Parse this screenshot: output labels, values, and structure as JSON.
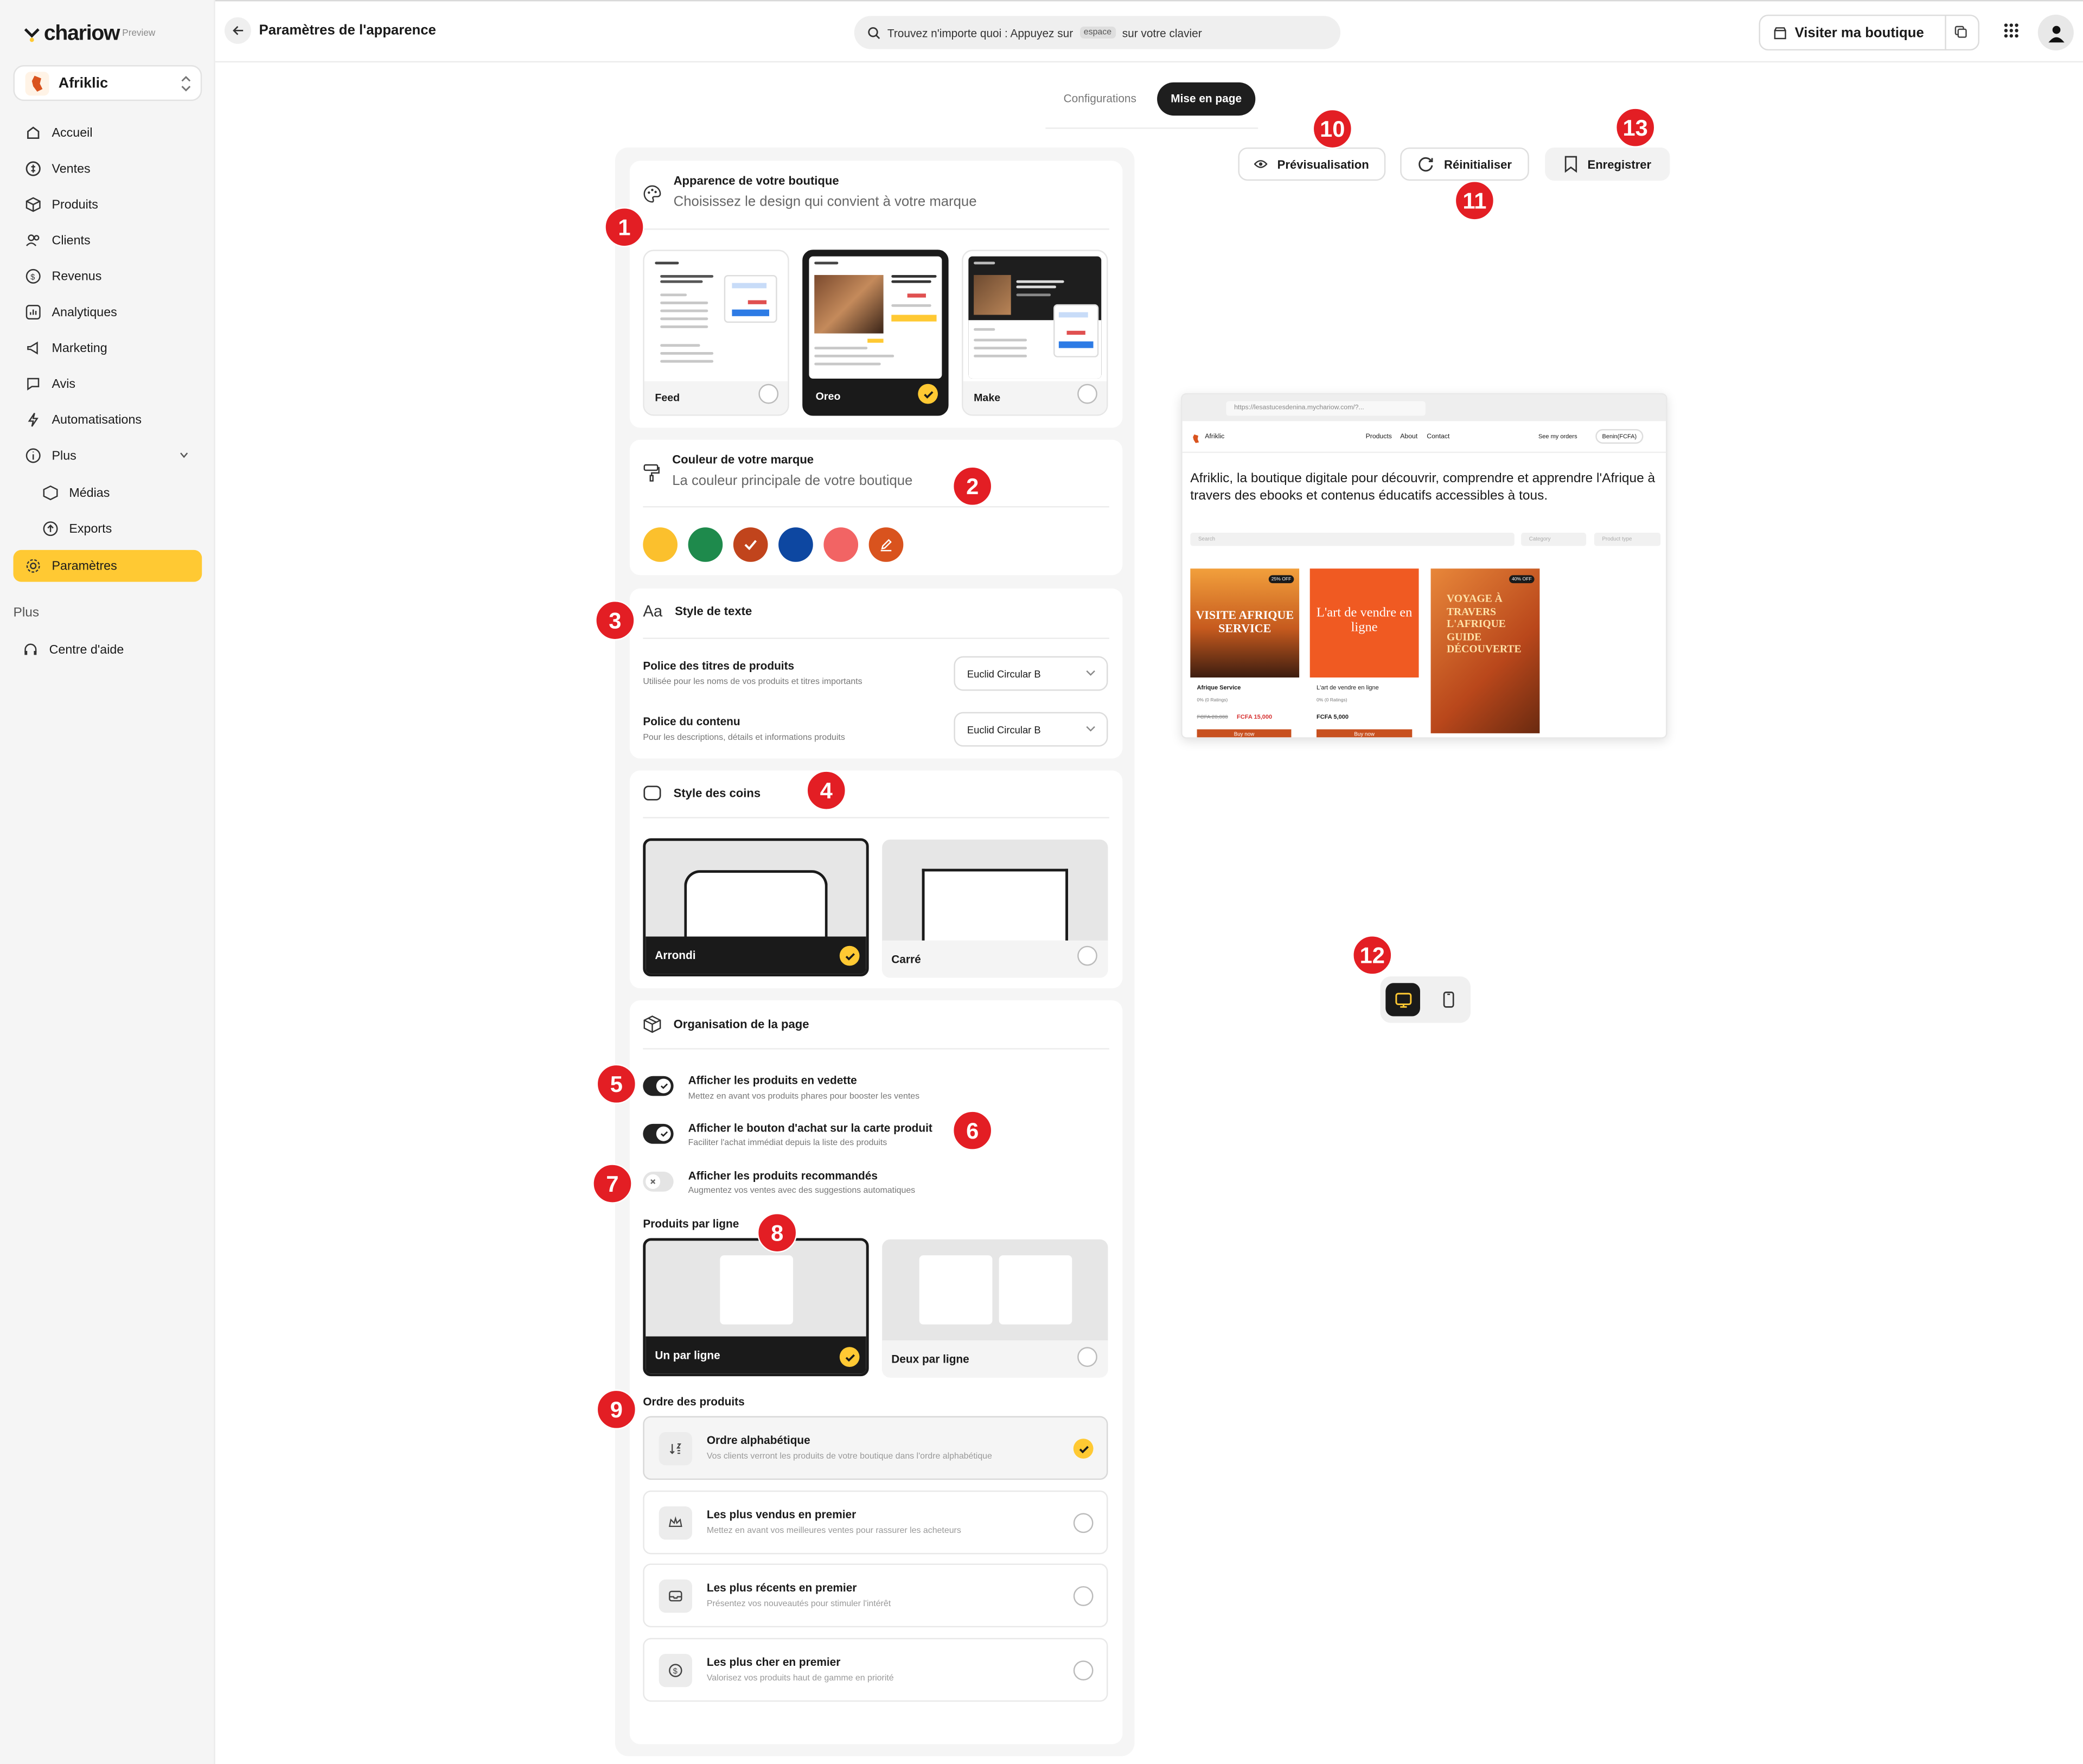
{
  "app": {
    "logo_text": "chariow",
    "preview_tag": "Preview",
    "store_name": "Afriklic"
  },
  "sidebar": {
    "items": [
      {
        "label": "Accueil",
        "icon": "home-icon"
      },
      {
        "label": "Ventes",
        "icon": "dollar-icon"
      },
      {
        "label": "Produits",
        "icon": "box-icon"
      },
      {
        "label": "Clients",
        "icon": "users-icon"
      },
      {
        "label": "Revenus",
        "icon": "coin-icon"
      },
      {
        "label": "Analytiques",
        "icon": "chart-icon"
      },
      {
        "label": "Marketing",
        "icon": "megaphone-icon"
      },
      {
        "label": "Avis",
        "icon": "comment-icon"
      },
      {
        "label": "Automatisations",
        "icon": "bolt-icon"
      },
      {
        "label": "Plus",
        "icon": "info-icon"
      },
      {
        "label": "Médias",
        "icon": "media-icon"
      },
      {
        "label": "Exports",
        "icon": "export-icon"
      },
      {
        "label": "Paramètres",
        "icon": "settings-icon"
      }
    ],
    "section_label": "Plus",
    "help_label": "Centre d'aide"
  },
  "topbar": {
    "title": "Paramètres de l'apparence",
    "search_before": "Trouvez n'importe quoi : Appuyez sur",
    "search_key": "espace",
    "search_after": "sur votre clavier",
    "visit_label": "Visiter ma boutique"
  },
  "tabs": {
    "configurations": "Configurations",
    "layout": "Mise en page",
    "active": "Mise en page"
  },
  "appearance": {
    "title": "Apparence de votre boutique",
    "subtitle": "Choisissez le design qui convient à votre marque",
    "themes": [
      {
        "label": "Feed"
      },
      {
        "label": "Oreo"
      },
      {
        "label": "Make"
      }
    ],
    "selected": "Oreo"
  },
  "brand_color": {
    "title": "Couleur de votre marque",
    "subtitle": "La couleur principale de votre boutique",
    "colors": [
      "#fbc02d",
      "#1e8a4c",
      "#c1441c",
      "#0d47a1",
      "#f26464",
      "#d9531e"
    ],
    "selected": "#c1441c"
  },
  "text_style": {
    "title": "Style de texte",
    "title_font_label": "Police des titres de produits",
    "title_font_sub": "Utilisée pour les noms de vos produits et titres importants",
    "title_font_value": "Euclid Circular B",
    "body_font_label": "Police du contenu",
    "body_font_sub": "Pour les descriptions, détails et informations produits",
    "body_font_value": "Euclid Circular B"
  },
  "corners": {
    "title": "Style des coins",
    "options": [
      {
        "label": "Arrondi"
      },
      {
        "label": "Carré"
      }
    ],
    "selected": "Arrondi"
  },
  "organization": {
    "title": "Organisation de la page",
    "toggles": [
      {
        "label": "Afficher les produits en vedette",
        "sub": "Mettez en avant vos produits phares pour booster les ventes",
        "on": true
      },
      {
        "label": "Afficher le bouton d'achat sur la carte produit",
        "sub": "Faciliter l'achat immédiat depuis la liste des produits",
        "on": true
      },
      {
        "label": "Afficher les produits recommandés",
        "sub": "Augmentez vos ventes avec des suggestions automatiques",
        "on": false
      }
    ],
    "per_row_label": "Produits par ligne",
    "per_row_options": [
      {
        "label": "Un par ligne"
      },
      {
        "label": "Deux par ligne"
      }
    ],
    "per_row_selected": "Un par ligne",
    "order_label": "Ordre des produits",
    "orders": [
      {
        "title": "Ordre alphabétique",
        "sub": "Vos clients verront les produits de votre boutique dans l'ordre alphabétique",
        "icon": "sort-az-icon"
      },
      {
        "title": "Les plus vendus en premier",
        "sub": "Mettez en avant vos meilleures ventes pour rassurer les acheteurs",
        "icon": "crown-icon"
      },
      {
        "title": "Les plus récents en premier",
        "sub": "Présentez vos nouveautés pour stimuler l'intérêt",
        "icon": "inbox-icon"
      },
      {
        "title": "Les plus cher en premier",
        "sub": "Valorisez vos produits haut de gamme en priorité",
        "icon": "money-icon"
      }
    ],
    "order_selected": "Ordre alphabétique"
  },
  "actions": {
    "preview": "Prévisualisation",
    "reset": "Réinitialiser",
    "save": "Enregistrer"
  },
  "store_preview": {
    "url": "https://lesastucesdenina.mychariow.com/?...",
    "store": "Afriklic",
    "nav": [
      "Products",
      "About",
      "Contact"
    ],
    "orders": "See my orders",
    "currency": "Benin(FCFA)",
    "hero": "Afriklic, la boutique digitale pour découvrir, comprendre et apprendre l'Afrique à travers des ebooks et contenus éducatifs accessibles à tous.",
    "search": "Search",
    "category": "Category",
    "product_type": "Product type",
    "products": [
      {
        "name": "Afrique Service",
        "rating": "0% (0 Ratings)",
        "old": "FCFA 20,000",
        "price": "FCFA 15,000",
        "badge": "25% OFF",
        "cover": "VISITE AFRIQUE SERVICE",
        "buy": "Buy now"
      },
      {
        "name": "L'art de vendre en ligne",
        "rating": "0% (0 Ratings)",
        "price": "FCFA 5,000",
        "cover": "L'art de vendre en ligne",
        "buy": "Buy now"
      },
      {
        "name": "",
        "cover": "VOYAGE À TRAVERS L'AFRIQUE GUIDE DÉCOUVERTE",
        "badge": "40% OFF"
      }
    ]
  },
  "device_toggle": {
    "selected": "desktop",
    "options": [
      "desktop-icon",
      "mobile-icon"
    ]
  },
  "annotations": [
    "1",
    "2",
    "3",
    "4",
    "5",
    "6",
    "7",
    "8",
    "9",
    "10",
    "11",
    "12",
    "13"
  ],
  "colors": {
    "accent": "#ffc933",
    "dark": "#1a1a1a",
    "badge": "#e31e24"
  }
}
